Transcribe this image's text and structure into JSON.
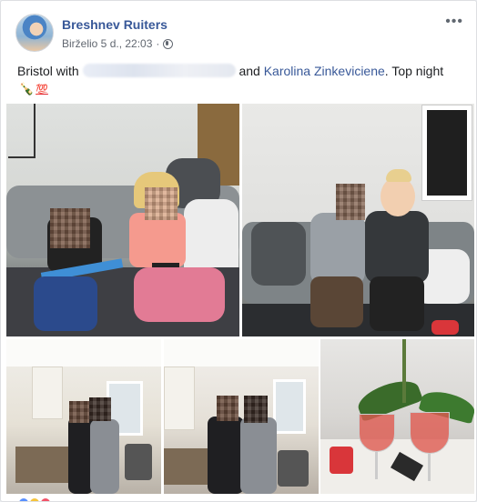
{
  "post": {
    "author": "Breshnev Ruiters",
    "timestamp": "Birželio 5 d., 22:03",
    "separator": "·",
    "privacy_icon": "globe-icon",
    "more_label": "•••",
    "text_prefix": "Bristol with",
    "text_and": "and",
    "tagged_person": "Karolina Zinkeviciene",
    "text_suffix": ". Top night",
    "emoji_bottle": "🍾",
    "emoji_hundred": "💯"
  },
  "photos": [
    {
      "description_name": "photo-1"
    },
    {
      "description_name": "photo-2"
    },
    {
      "description_name": "photo-3"
    },
    {
      "description_name": "photo-4"
    },
    {
      "description_name": "photo-5"
    }
  ],
  "colors": {
    "link": "#385898",
    "text": "#1c1e21",
    "meta": "#616770",
    "card_border": "#dddfe2"
  }
}
